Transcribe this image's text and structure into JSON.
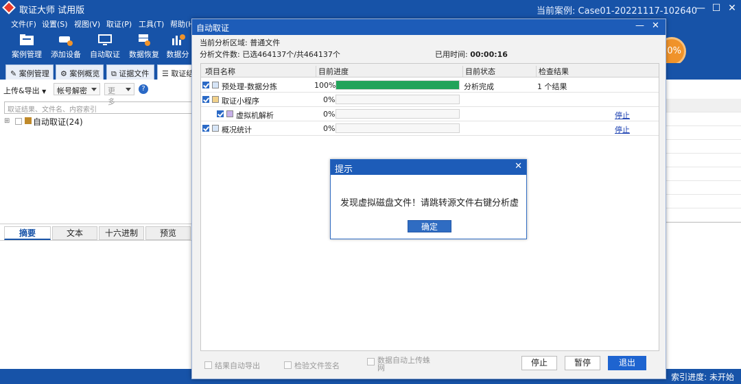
{
  "app": {
    "title": "取证大师 试用版",
    "case_label": "当前案例:",
    "case_name": "Case01-20221117-102640",
    "win_min": "—",
    "win_max": "☐",
    "win_close": "✕"
  },
  "menu": [
    "文件(F)",
    "设置(S)",
    "视图(V)",
    "取证(P)",
    "工具(T)",
    "帮助(H"
  ],
  "toolbar": [
    "案例管理",
    "添加设备",
    "自动取证",
    "数据恢复",
    "数据分"
  ],
  "progress_badge": "0%",
  "tabs": [
    "案例管理",
    "案例概览",
    "证据文件",
    "取证结"
  ],
  "left": {
    "upload_export": "上传&导出",
    "account_decrypt": "帐号解密",
    "more": "更多",
    "search_placeholder": "取证结果、文件名、内容索引",
    "tree_item": "自动取证(24)"
  },
  "bottom_tabs": [
    "摘要",
    "文本",
    "十六进制",
    "预览"
  ],
  "status": {
    "index_progress": "索引进度: 未开始"
  },
  "dialog": {
    "title": "自动取证",
    "min": "—",
    "close": "✕",
    "area_label": "当前分析区域:",
    "area_value": "普通文件",
    "file_count_label": "分析文件数:",
    "file_count_value": "已选464137个/共464137个",
    "elapsed_label": "已用时间:",
    "elapsed_value": "00:00:16",
    "columns": [
      "项目名称",
      "目前进度",
      "目前状态",
      "检查结果"
    ],
    "rows": [
      {
        "name": "预处理-数据分拣",
        "progress": 100,
        "percent": "100%",
        "status": "分析完成",
        "result": "1 个结果",
        "action": ""
      },
      {
        "name": "取证小程序",
        "progress": 0,
        "percent": "0%",
        "status": "",
        "result": "",
        "action": ""
      },
      {
        "name": "虚拟机解析",
        "progress": 0,
        "percent": "0%",
        "status": "",
        "result": "",
        "action": "停止"
      },
      {
        "name": "概况统计",
        "progress": 0,
        "percent": "0%",
        "status": "",
        "result": "",
        "action": "停止"
      }
    ],
    "opt_export": "结果自动导出",
    "opt_signature": "检验文件签名",
    "opt_upload": "数据自动上传蛛网",
    "btn_stop": "停止",
    "btn_pause": "暂停",
    "btn_exit": "退出"
  },
  "alert": {
    "title": "提示",
    "close": "✕",
    "message": "发现虚拟磁盘文件！请跳转源文件右键分析虚",
    "ok": "确定"
  },
  "colors": {
    "primary": "#1753a8",
    "progress": "#21a35a",
    "badge": "#f0932a"
  }
}
